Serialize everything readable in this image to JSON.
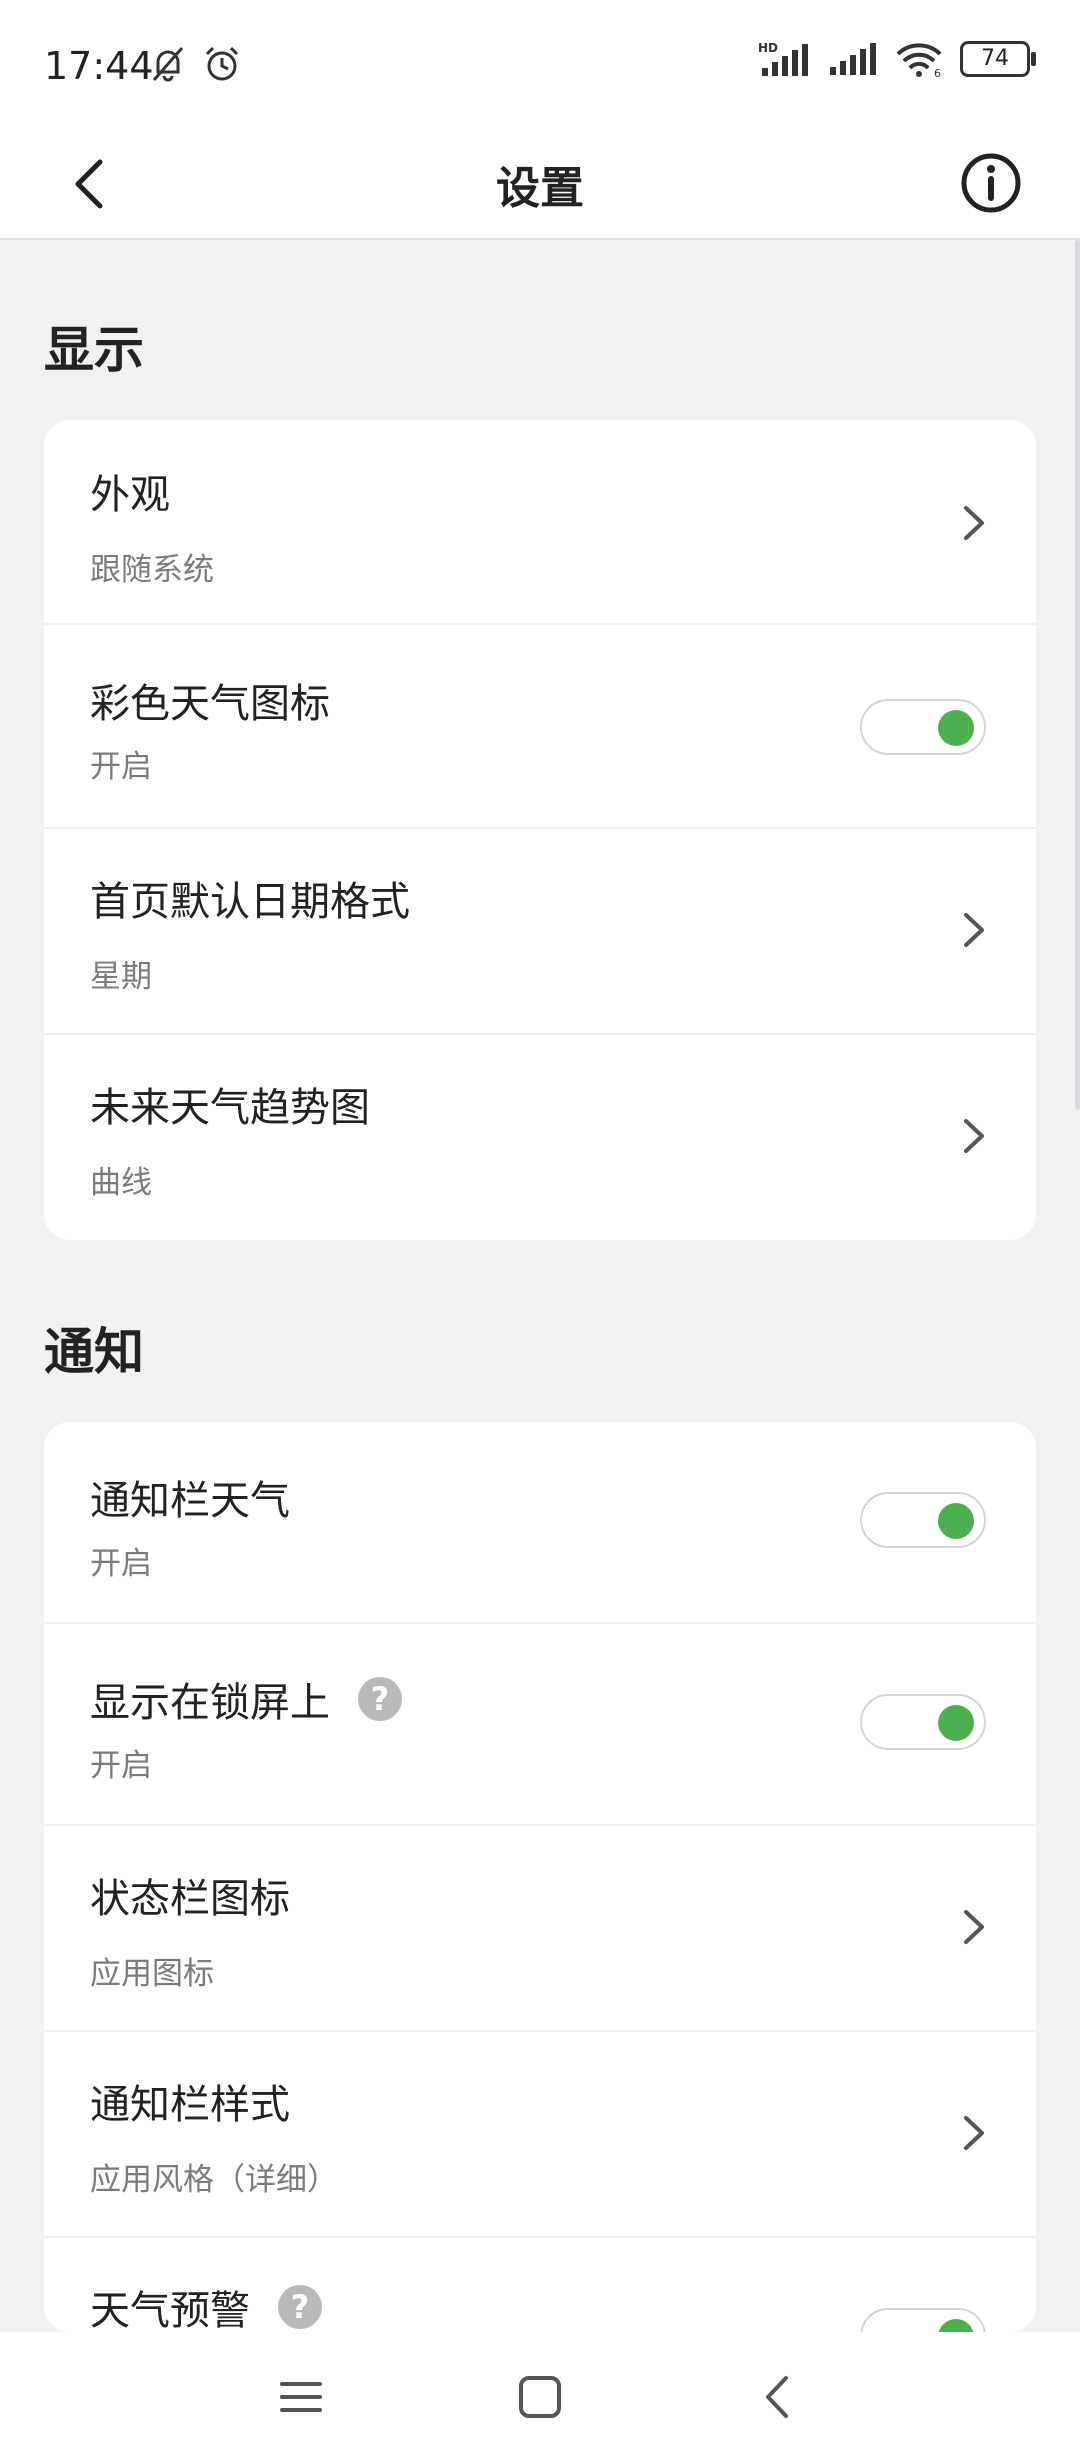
{
  "status_bar": {
    "time": "17:44",
    "battery": "74",
    "network_label": "HD",
    "icons": [
      "bell-off-icon",
      "alarm-icon",
      "signal-hd-icon",
      "signal-icon",
      "wifi-6-icon",
      "battery-icon"
    ]
  },
  "app_bar": {
    "title": "设置",
    "back_icon": "back-arrow-icon",
    "info_icon": "info-icon"
  },
  "sections": {
    "display": {
      "title": "显示",
      "items": [
        {
          "title": "外观",
          "subtitle": "跟随系统",
          "control": "chevron"
        },
        {
          "title": "彩色天气图标",
          "subtitle": "开启",
          "control": "toggle",
          "enabled": true
        },
        {
          "title": "首页默认日期格式",
          "subtitle": "星期",
          "control": "chevron"
        },
        {
          "title": "未来天气趋势图",
          "subtitle": "曲线",
          "control": "chevron"
        }
      ]
    },
    "notify": {
      "title": "通知",
      "items": [
        {
          "title": "通知栏天气",
          "subtitle": "开启",
          "control": "toggle",
          "enabled": true
        },
        {
          "title": "显示在锁屏上",
          "subtitle": "开启",
          "control": "toggle",
          "enabled": true,
          "help_glyph": "?"
        },
        {
          "title": "状态栏图标",
          "subtitle": "应用图标",
          "control": "chevron"
        },
        {
          "title": "通知栏样式",
          "subtitle": "应用风格（详细）",
          "control": "chevron"
        },
        {
          "title": "天气预警",
          "control": "toggle",
          "enabled": true,
          "help_glyph": "?"
        }
      ]
    }
  },
  "nav_bar": {
    "buttons": [
      "menu-icon",
      "home-icon",
      "back-icon"
    ]
  },
  "colors": {
    "accent": "#4caf50",
    "background": "#f0f1f3",
    "card": "#ffffff"
  }
}
